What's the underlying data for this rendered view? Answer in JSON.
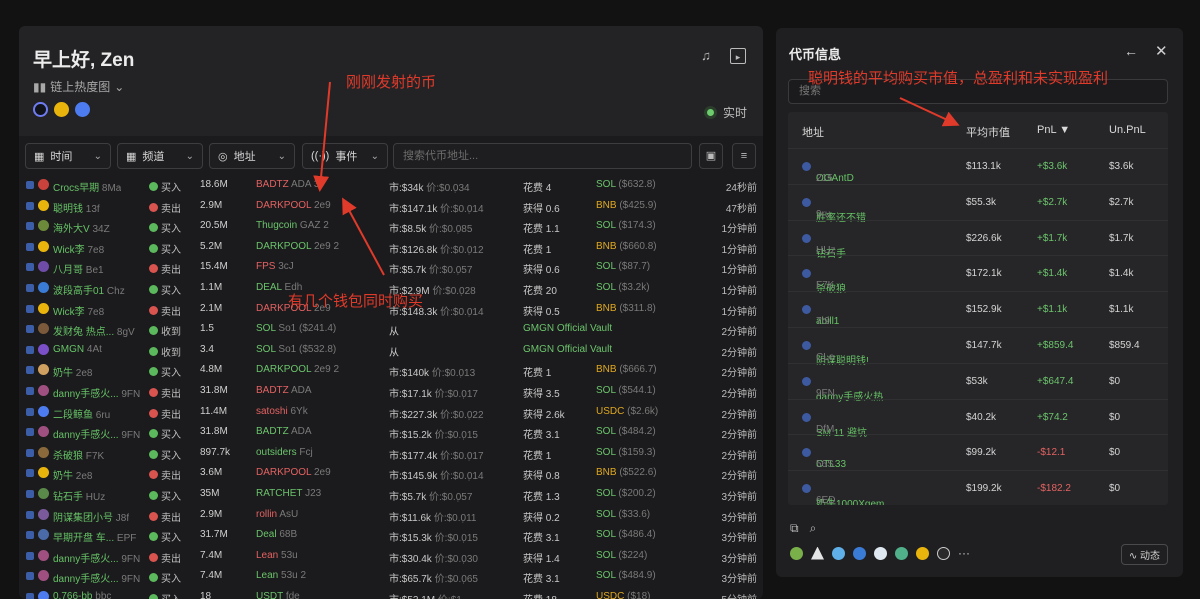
{
  "header": {
    "greeting": "早上好, Zen",
    "heatmap_label": "链上热度图",
    "live_label": "实时"
  },
  "toolbar": {
    "time": "时间",
    "channel": "频道",
    "address": "地址",
    "event": "事件",
    "search_placeholder": "搜索代币地址..."
  },
  "rows": [
    {
      "name": "Crocs早期",
      "suf": "8Ma",
      "act": "买入",
      "amt": "18.6M",
      "tok": "BADTZ",
      "tok2": "ADA",
      "tokc": "r",
      "count": "3",
      "mcap": "市:$34k",
      "price": "价:$0.0̣34",
      "fee_l": "花费",
      "fee": "4",
      "cur": "SOL",
      "curv": "($632.8)",
      "time": "24秒前"
    },
    {
      "name": "聪明钱",
      "suf": "13f",
      "act": "卖出",
      "amt": "2.9M",
      "tok": "DARKPOOL",
      "tok2": "2e9",
      "tokc": "r",
      "count": "",
      "mcap": "市:$147.1k",
      "price": "价:$0.0̣14",
      "fee_l": "获得",
      "fee": "0.6",
      "cur": "BNB",
      "curv": "($425.9)",
      "time": "47秒前"
    },
    {
      "name": "海外大V",
      "suf": "34Z",
      "act": "买入",
      "amt": "20.5M",
      "tok": "Thugcoin",
      "tok2": "GAZ",
      "tokc": "g",
      "count": "2",
      "mcap": "市:$8.5k",
      "price": "价:$0.0̣85",
      "fee_l": "花费",
      "fee": "1.1",
      "cur": "SOL",
      "curv": "($174.3)",
      "time": "1分钟前"
    },
    {
      "name": "Wick李",
      "suf": "7e8",
      "act": "买入",
      "amt": "5.2M",
      "tok": "DARKPOOL",
      "tok2": "2e9",
      "tokc": "g",
      "count": "2",
      "mcap": "市:$126.8k",
      "price": "价:$0.0̣12",
      "fee_l": "花费",
      "fee": "1",
      "cur": "BNB",
      "curv": "($660.8)",
      "time": "1分钟前"
    },
    {
      "name": "八月哥",
      "suf": "Be1",
      "act": "卖出",
      "amt": "15.4M",
      "tok": "FPS",
      "tok2": "3cJ",
      "tokc": "r",
      "count": "",
      "mcap": "市:$5.7k",
      "price": "价:$0.0̣57",
      "fee_l": "获得",
      "fee": "0.6",
      "cur": "SOL",
      "curv": "($87.7)",
      "time": "1分钟前"
    },
    {
      "name": "波段高手01",
      "suf": "Chz",
      "act": "买入",
      "amt": "1.1M",
      "tok": "DEAL",
      "tok2": "Edh",
      "tokc": "g",
      "count": "",
      "mcap": "市:$2.9M",
      "price": "价:$0.0̣28",
      "fee_l": "花费",
      "fee": "20",
      "cur": "SOL",
      "curv": "($3.2k)",
      "time": "1分钟前"
    },
    {
      "name": "Wick李",
      "suf": "7e8",
      "act": "卖出",
      "amt": "2.1M",
      "tok": "DARKPOOL",
      "tok2": "2e9",
      "tokc": "r",
      "count": "",
      "mcap": "市:$148.3k",
      "price": "价:$0.0̣14",
      "fee_l": "获得",
      "fee": "0.5",
      "cur": "BNB",
      "curv": "($311.8)",
      "time": "1分钟前"
    },
    {
      "name": "发财兔 热点...",
      "suf": "8gV",
      "act": "收到",
      "amt": "1.5",
      "tok": "SOL",
      "tok2": "So1 ($241.4)",
      "tokc": "g",
      "count": "",
      "mcap": "从",
      "price": "",
      "fee_l": "GMGN Official Vault",
      "fee": "",
      "cur": "",
      "curv": "",
      "time": "2分钟前"
    },
    {
      "name": "GMGN",
      "suf": "4At",
      "act": "收到",
      "amt": "3.4",
      "tok": "SOL",
      "tok2": "So1 ($532.8)",
      "tokc": "g",
      "count": "",
      "mcap": "从",
      "price": "",
      "fee_l": "GMGN Official Vault",
      "fee": "",
      "cur": "",
      "curv": "",
      "time": "2分钟前"
    },
    {
      "name": "奶牛",
      "suf": "2e8",
      "act": "买入",
      "amt": "4.8M",
      "tok": "DARKPOOL",
      "tok2": "2e9",
      "tokc": "g",
      "count": "2",
      "mcap": "市:$140k",
      "price": "价:$0.0̣13",
      "fee_l": "花费",
      "fee": "1",
      "cur": "BNB",
      "curv": "($666.7)",
      "time": "2分钟前"
    },
    {
      "name": "danny手感火...",
      "suf": "9FN",
      "act": "卖出",
      "amt": "31.8M",
      "tok": "BADTZ",
      "tok2": "ADA",
      "tokc": "r",
      "count": "",
      "mcap": "市:$17.1k",
      "price": "价:$0.0̣17",
      "fee_l": "获得",
      "fee": "3.5",
      "cur": "SOL",
      "curv": "($544.1)",
      "time": "2分钟前"
    },
    {
      "name": "二段鲸鱼",
      "suf": "6ru",
      "act": "卖出",
      "amt": "11.4M",
      "tok": "satoshi",
      "tok2": "6Yk",
      "tokc": "r",
      "count": "",
      "mcap": "市:$227.3k",
      "price": "价:$0.0̣22",
      "fee_l": "获得",
      "fee": "2.6k",
      "cur": "USDC",
      "curv": "($2.6k)",
      "time": "2分钟前"
    },
    {
      "name": "danny手感火...",
      "suf": "9FN",
      "act": "买入",
      "amt": "31.8M",
      "tok": "BADTZ",
      "tok2": "ADA",
      "tokc": "g",
      "count": "",
      "mcap": "市:$15.2k",
      "price": "价:$0.0̣15",
      "fee_l": "花费",
      "fee": "3.1",
      "cur": "SOL",
      "curv": "($484.2)",
      "time": "2分钟前"
    },
    {
      "name": "杀破狼",
      "suf": "F7K",
      "act": "买入",
      "amt": "897.7k",
      "tok": "outsiders",
      "tok2": "Fcj",
      "tokc": "g",
      "count": "",
      "mcap": "市:$177.4k",
      "price": "价:$0.0̣17",
      "fee_l": "花费",
      "fee": "1",
      "cur": "SOL",
      "curv": "($159.3)",
      "time": "2分钟前"
    },
    {
      "name": "奶牛",
      "suf": "2e8",
      "act": "卖出",
      "amt": "3.6M",
      "tok": "DARKPOOL",
      "tok2": "2e9",
      "tokc": "r",
      "count": "",
      "mcap": "市:$145.9k",
      "price": "价:$0.0̣14",
      "fee_l": "获得",
      "fee": "0.8",
      "cur": "BNB",
      "curv": "($522.6)",
      "time": "2分钟前"
    },
    {
      "name": "钻石手",
      "suf": "HUz",
      "act": "买入",
      "amt": "35M",
      "tok": "RATCHET",
      "tok2": "J23",
      "tokc": "g",
      "count": "",
      "mcap": "市:$5.7k",
      "price": "价:$0.0̣57",
      "fee_l": "花费",
      "fee": "1.3",
      "cur": "SOL",
      "curv": "($200.2)",
      "time": "3分钟前"
    },
    {
      "name": "阴谋集团小号",
      "suf": "J8f",
      "act": "卖出",
      "amt": "2.9M",
      "tok": "rollin",
      "tok2": "AsU",
      "tokc": "r",
      "count": "",
      "mcap": "市:$11.6k",
      "price": "价:$0.0̣11",
      "fee_l": "获得",
      "fee": "0.2",
      "cur": "SOL",
      "curv": "($33.6)",
      "time": "3分钟前"
    },
    {
      "name": "早期开盘 车...",
      "suf": "EPF",
      "act": "买入",
      "amt": "31.7M",
      "tok": "Deal",
      "tok2": "68B",
      "tokc": "g",
      "count": "",
      "mcap": "市:$15.3k",
      "price": "价:$0.0̣15",
      "fee_l": "花费",
      "fee": "3.1",
      "cur": "SOL",
      "curv": "($486.4)",
      "time": "3分钟前"
    },
    {
      "name": "danny手感火...",
      "suf": "9FN",
      "act": "卖出",
      "amt": "7.4M",
      "tok": "Lean",
      "tok2": "53u",
      "tokc": "r",
      "count": "",
      "mcap": "市:$30.4k",
      "price": "价:$0.0̣30",
      "fee_l": "获得",
      "fee": "1.4",
      "cur": "SOL",
      "curv": "($224)",
      "time": "3分钟前"
    },
    {
      "name": "danny手感火...",
      "suf": "9FN",
      "act": "买入",
      "amt": "7.4M",
      "tok": "Lean",
      "tok2": "53u",
      "tokc": "g",
      "count": "2",
      "mcap": "市:$65.7k",
      "price": "价:$0.0̣65",
      "fee_l": "花费",
      "fee": "3.1",
      "cur": "SOL",
      "curv": "($484.9)",
      "time": "3分钟前"
    },
    {
      "name": "0.766-bb",
      "suf": "bbc",
      "act": "买入",
      "amt": "18",
      "tok": "USDT",
      "tok2": "fde",
      "tokc": "g",
      "count": "",
      "mcap": "市:$52.1M",
      "price": "价:$1",
      "fee_l": "花费",
      "fee": "18",
      "cur": "USDC",
      "curv": "($18)",
      "time": "5分钟前"
    }
  ],
  "right_panel": {
    "title": "代币信息",
    "search_placeholder": "搜索",
    "col_address": "地址",
    "col_avg_cap": "平均市值",
    "col_pnl": "PnL ▼",
    "col_unpnl": "Un.PnL",
    "rows": [
      {
        "name": "OGAntD",
        "suf": "215",
        "cap": "$113.1k",
        "pnl": "+$3.6k",
        "un": "$3.6k",
        "pc": "g"
      },
      {
        "name": "胜率还不错",
        "suf": "9ru",
        "cap": "$55.3k",
        "pnl": "+$2.7k",
        "un": "$2.7k",
        "pc": "g"
      },
      {
        "name": "钻石手",
        "suf": "HUz",
        "cap": "$226.6k",
        "pnl": "+$1.7k",
        "un": "$1.7k",
        "pc": "g"
      },
      {
        "name": "杀破狼",
        "suf": "F7K",
        "cap": "$172.1k",
        "pnl": "+$1.4k",
        "un": "$1.4k",
        "pc": "g"
      },
      {
        "name": "abill1",
        "suf": "7t9",
        "cap": "$152.9k",
        "pnl": "+$1.1k",
        "un": "$1.1k",
        "pc": "g"
      },
      {
        "name": "阴谋聪明钱!",
        "suf": "CLe",
        "cap": "$147.7k",
        "pnl": "+$859.4",
        "un": "$859.4",
        "pc": "g"
      },
      {
        "name": "danny手感火热",
        "suf": "9FN",
        "cap": "$53k",
        "pnl": "+$647.4",
        "un": "$0",
        "pc": "g"
      },
      {
        "name": "SM 11 避坑",
        "suf": "DfM",
        "cap": "$40.2k",
        "pnl": "+$74.2",
        "un": "$0",
        "pc": "g"
      },
      {
        "name": "CTL33",
        "suf": "56S",
        "cap": "$99.2k",
        "pnl": "-$12.1",
        "un": "$0",
        "pc": "r"
      },
      {
        "name": "奶牛1000Xgem",
        "suf": "6ED",
        "cap": "$199.2k",
        "pnl": "-$182.2",
        "un": "$0",
        "pc": "r"
      }
    ],
    "dynamic_label": "动态"
  },
  "annotations": {
    "just_launched": "刚刚发射的币",
    "multi_wallets": "有几个钱包同时购买",
    "smart_money": "聪明钱的平均购买市值，总盈利和未实现盈利"
  },
  "colors": {
    "buy": "#6cc46c",
    "sell": "#e46262",
    "annotation": "#e03a2a"
  }
}
